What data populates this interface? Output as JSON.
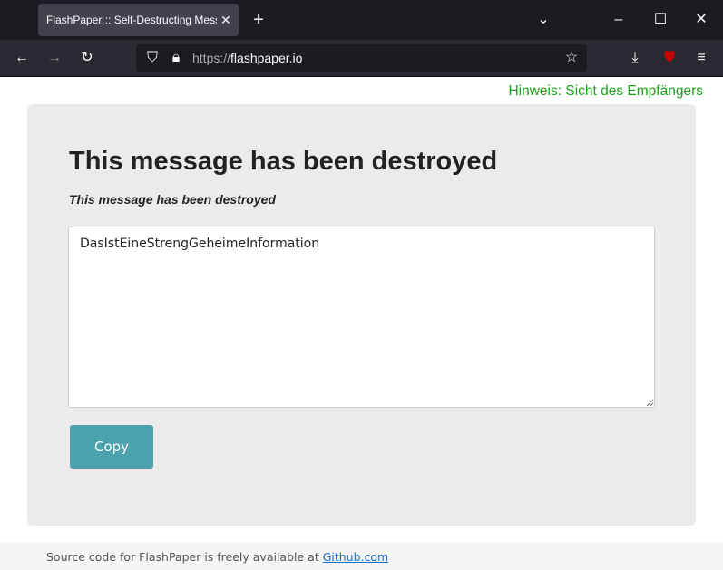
{
  "browser": {
    "tab_title": "FlashPaper :: Self-Destructing Messa",
    "url_scheme": "https://",
    "url_host": "flashpaper.io"
  },
  "page": {
    "hint": "Hinweis: Sicht des Empfängers",
    "title": "This message has been destroyed",
    "subtitle": "This message has been destroyed",
    "message": "DasIstEineStrengGeheimeInformation",
    "copy_label": "Copy",
    "footer_text": "Source code for FlashPaper is freely available at ",
    "footer_link": "Github.com"
  },
  "colors": {
    "accent": "#4ba2ad",
    "hint": "#1aa31a"
  }
}
